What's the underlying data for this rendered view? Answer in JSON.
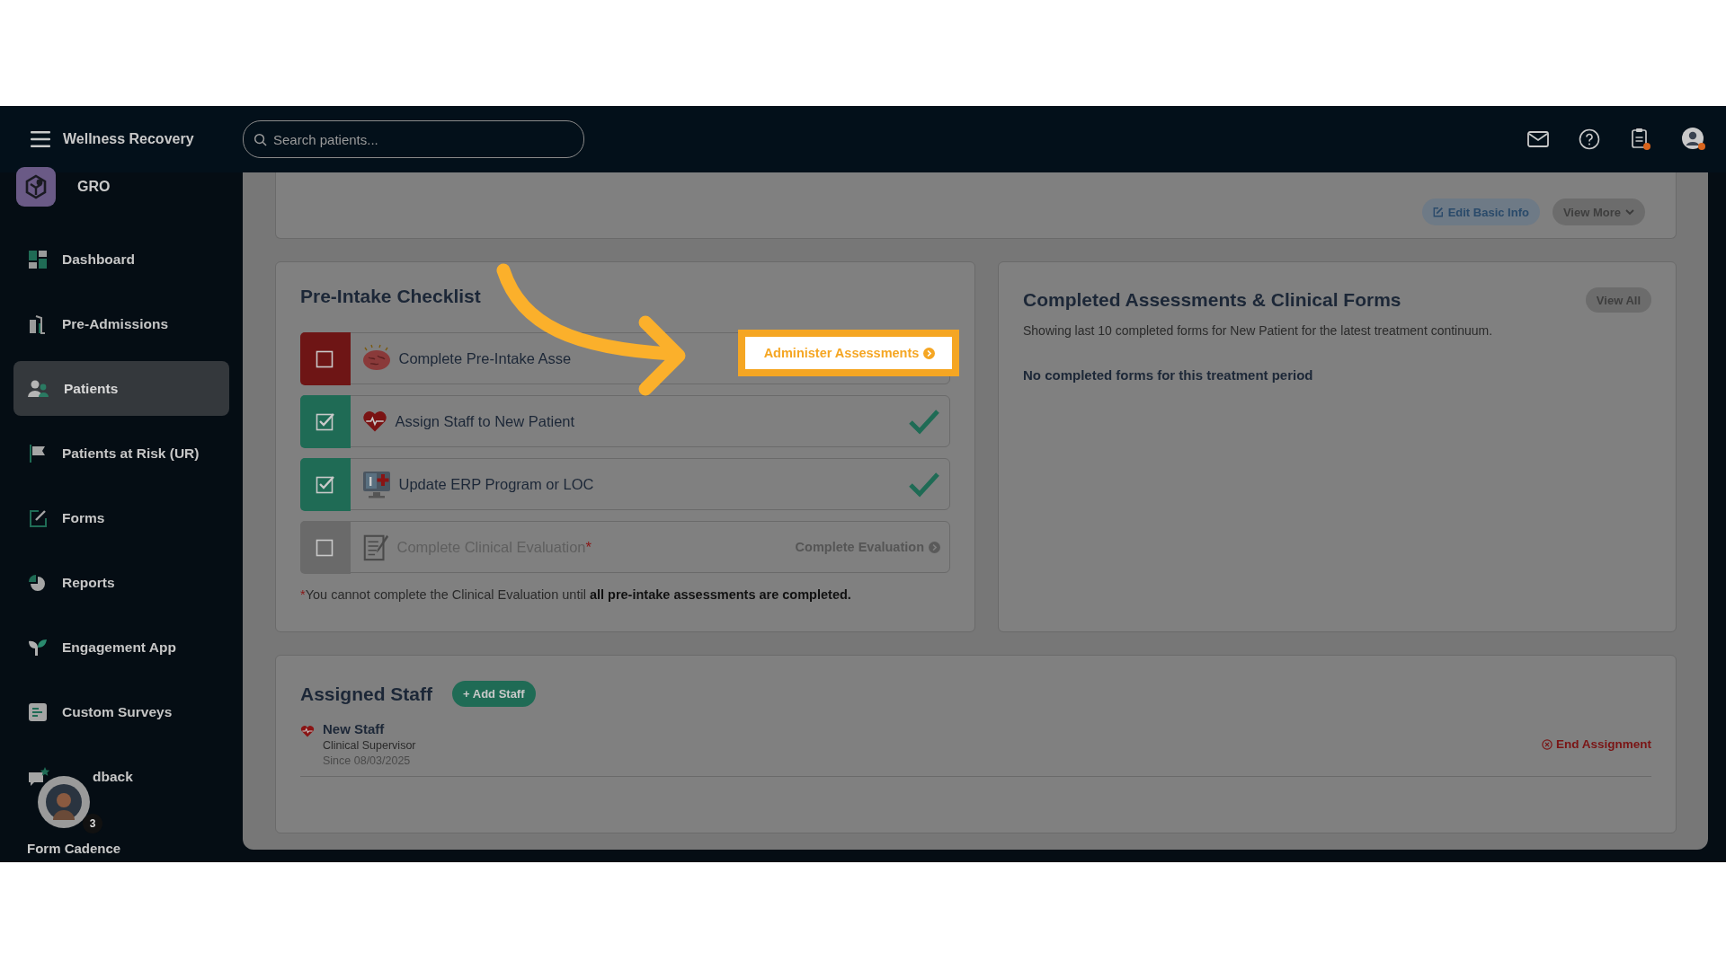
{
  "header": {
    "brand": "Wellness Recovery",
    "search": {
      "placeholder": "Search patients..."
    }
  },
  "sidebar": {
    "org": "GRO",
    "items": [
      {
        "label": "Dashboard",
        "selected": false
      },
      {
        "label": "Pre-Admissions",
        "selected": false
      },
      {
        "label": "Patients",
        "selected": true
      },
      {
        "label": "Patients at Risk (UR)",
        "selected": false
      },
      {
        "label": "Forms",
        "selected": false
      },
      {
        "label": "Reports",
        "selected": false
      },
      {
        "label": "Engagement App",
        "selected": false
      },
      {
        "label": "Custom Surveys",
        "selected": false
      },
      {
        "label": "dback",
        "selected": false
      }
    ],
    "widget": {
      "name": "Form Cadence",
      "badge": "3"
    }
  },
  "patient_card": {
    "buttons": [
      "Edit Basic Info",
      "View More"
    ]
  },
  "checklist": {
    "title": "Pre-Intake Checklist",
    "items": [
      {
        "label": "Complete Pre-Intake Asse",
        "checked": false,
        "disabled": false,
        "action": "Administer Assessments",
        "highlighted": true
      },
      {
        "label": "Assign Staff to New Patient",
        "checked": true,
        "disabled": false
      },
      {
        "label": "Update ERP Program or LOC",
        "checked": true,
        "disabled": false
      },
      {
        "label": "Complete Clinical Evaluation",
        "marker": "*",
        "checked": false,
        "disabled": true,
        "action": "Complete Evaluation",
        "highlighted": false
      }
    ],
    "note": {
      "marker": "*",
      "text": "You cannot complete the Clinical Evaluation until **all pre-intake assessments are completed.**"
    }
  },
  "completed": {
    "title": "Completed Assessments & Clinical Forms",
    "button": "View All",
    "subtitle": "Showing last 10 completed forms for New Patient for the latest treatment continuum.",
    "empty": "No completed forms for this treatment period"
  },
  "assigned": {
    "title": "Assigned Staff",
    "button": "+ Add Staff",
    "staff": [
      {
        "name": "New Staff",
        "role": "Clinical Supervisor",
        "since": "Since 08/03/2025",
        "action": "End Assignment"
      }
    ]
  }
}
